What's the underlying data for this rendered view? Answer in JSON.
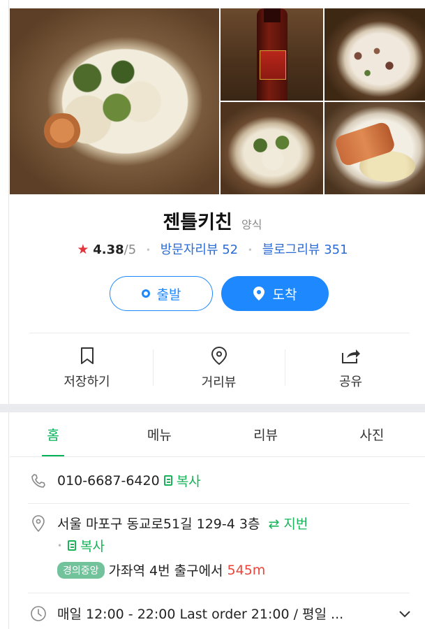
{
  "place": {
    "name": "젠틀키친",
    "category": "양식",
    "rating": "4.38",
    "rating_max": "/5",
    "visitor_reviews": "방문자리뷰 52",
    "blog_reviews": "블로그리뷰 351"
  },
  "buttons": {
    "start": "출발",
    "arrive": "도착"
  },
  "actions": [
    {
      "label": "저장하기",
      "icon": "bookmark-icon"
    },
    {
      "label": "거리뷰",
      "icon": "location-pin-icon"
    },
    {
      "label": "공유",
      "icon": "share-icon"
    }
  ],
  "tabs": [
    "홈",
    "메뉴",
    "리뷰",
    "사진"
  ],
  "active_tab": "홈",
  "info": {
    "phone": "010-6687-6420",
    "copy_label": "복사",
    "address": "서울 마포구 동교로51길 129-4 3층",
    "jibun_label": "지번",
    "subway_line": "경의중앙",
    "station_text": "가좌역 4번 출구에서",
    "distance": "545m",
    "hours": "매일 12:00 - 22:00 Last order 21:00 / 평일 ..."
  },
  "colors": {
    "accent_green": "#03b159",
    "accent_blue": "#1e88ff",
    "star_red": "#e3333b",
    "distance_red": "#e8463a"
  }
}
